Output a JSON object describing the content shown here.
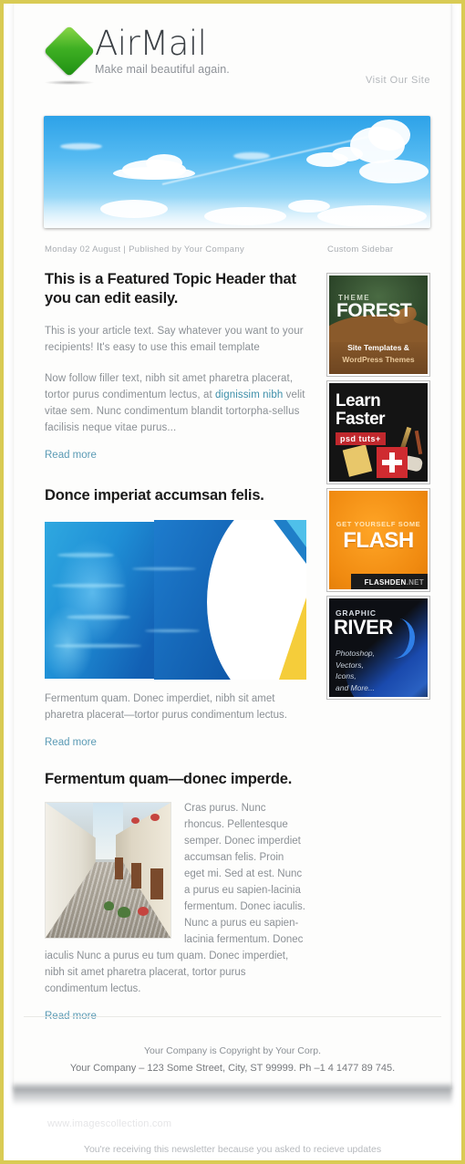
{
  "brand": {
    "name": "AirMail",
    "tagline": "Make mail beautiful again.",
    "logo_icon": "green-diamond-logo",
    "visit_link": "Visit Our Site"
  },
  "hero": {
    "image_alt": "blue-sky-with-clouds-banner"
  },
  "meta": {
    "left": "Monday 02 August | Published by Your Company",
    "right": "Custom Sidebar"
  },
  "articles": [
    {
      "title": "This is a Featured Topic Header that you can edit easily.",
      "intro": "This is your article text. Say whatever you want to your recipients! It's easy to use this email template",
      "body_before_link": "Now follow filler text, nibh sit amet pharetra placerat, tortor purus condimentum lectus, at ",
      "body_link": "dignissim nibh",
      "body_after_link": " velit vitae sem. Nunc condimentum blandit tortorpha-sellus facilisis neque vitae purus...",
      "read_more": "Read more"
    },
    {
      "title": "Donce imperiat accumsan felis.",
      "image_alt": "swimming-pool-water-photo",
      "caption": "Fermentum quam. Donec imperdiet, nibh sit amet pharetra placerat—tortor purus condimentum lectus.",
      "read_more": "Read more"
    },
    {
      "title": "Fermentum quam—donec imperde.",
      "image_alt": "cobblestone-street-photo",
      "body": "Cras purus. Nunc rhoncus. Pellentesque semper. Donec imperdiet accumsan felis. Proin eget mi. Sed at est. Nunc a purus eu sapien-lacinia fermentum. Donec iaculis. Nunc a purus eu sapien-lacinia fermentum. Donec iaculis Nunc a purus eu tum quam. Donec imperdiet, nibh sit amet pharetra placerat, tortor purus condimentum lectus.",
      "read_more": "Read more"
    }
  ],
  "sidebar": {
    "ads": [
      {
        "name": "themeforest",
        "eyebrow": "THEME",
        "title": "FOREST",
        "line1": "Site Templates &",
        "line2": "WordPress Themes"
      },
      {
        "name": "psdtuts",
        "line1": "Learn",
        "line2": "Faster",
        "badge": "psd tuts+"
      },
      {
        "name": "flashden",
        "eyebrow": "GET YOURSELF SOME",
        "title": "FLASH",
        "bar_main": "FLASHDEN",
        "bar_sub": ".NET"
      },
      {
        "name": "graphicriver",
        "eyebrow": "GRAPHIC",
        "title": "RIVER",
        "list": "Photoshop,\nVectors,\nIcons,\nand More..."
      }
    ]
  },
  "footer": {
    "copyright": "Your Company is Copyright by Your Corp.",
    "address": "Your Company – 123 Some Street, City, ST 99999. Ph –1 4 1477 89 745.",
    "watermark": "www.imagescollection.com",
    "bottom_note": "You're receiving this newsletter because you asked to recieve updates"
  },
  "colors": {
    "border": "#d9cb54",
    "link": "#5b9bb5",
    "logo_green": "#3fb023",
    "body_text": "#8b9095",
    "heading": "#1b1b1b"
  }
}
